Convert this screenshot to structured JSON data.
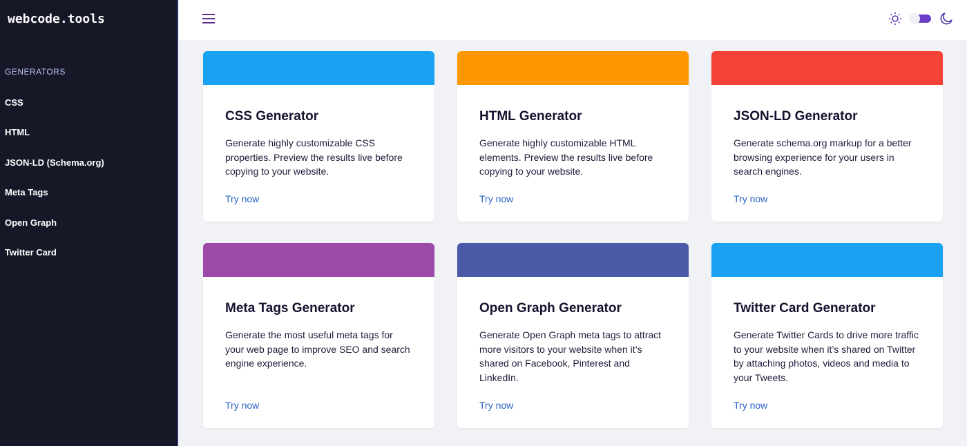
{
  "sidebar": {
    "logo": "webcode.tools",
    "section": "GENERATORS",
    "items": [
      {
        "label": "CSS"
      },
      {
        "label": "HTML"
      },
      {
        "label": "JSON-LD (Schema.org)"
      },
      {
        "label": "Meta Tags"
      },
      {
        "label": "Open Graph"
      },
      {
        "label": "Twitter Card"
      }
    ]
  },
  "header": {
    "icons": [
      "menu-icon",
      "sun-icon",
      "theme-toggle",
      "moon-icon"
    ]
  },
  "cards": [
    {
      "title": "CSS Generator",
      "desc": "Generate highly customizable CSS properties. Preview the results live before copying to your website.",
      "link": "Try now",
      "color": "#1ba1f2"
    },
    {
      "title": "HTML Generator",
      "desc": "Generate highly customizable HTML elements. Preview the results live before copying to your website.",
      "link": "Try now",
      "color": "#ff9800"
    },
    {
      "title": "JSON-LD Generator",
      "desc": "Generate schema.org markup for a better browsing experience for your users in search engines.",
      "link": "Try now",
      "color": "#f44336"
    },
    {
      "title": "Meta Tags Generator",
      "desc": "Generate the most useful meta tags for your web page to improve SEO and search engine experience.",
      "link": "Try now",
      "color": "#9b4aaa"
    },
    {
      "title": "Open Graph Generator",
      "desc": "Generate Open Graph meta tags to attract more visitors to your website when it’s shared on Facebook, Pinterest and LinkedIn.",
      "link": "Try now",
      "color": "#4a5aa6"
    },
    {
      "title": "Twitter Card Generator",
      "desc": "Generate Twitter Cards to drive more traffic to your website when it’s shared on Twitter by attaching photos, videos and media to your Tweets.",
      "link": "Try now",
      "color": "#1ba1f2"
    }
  ]
}
